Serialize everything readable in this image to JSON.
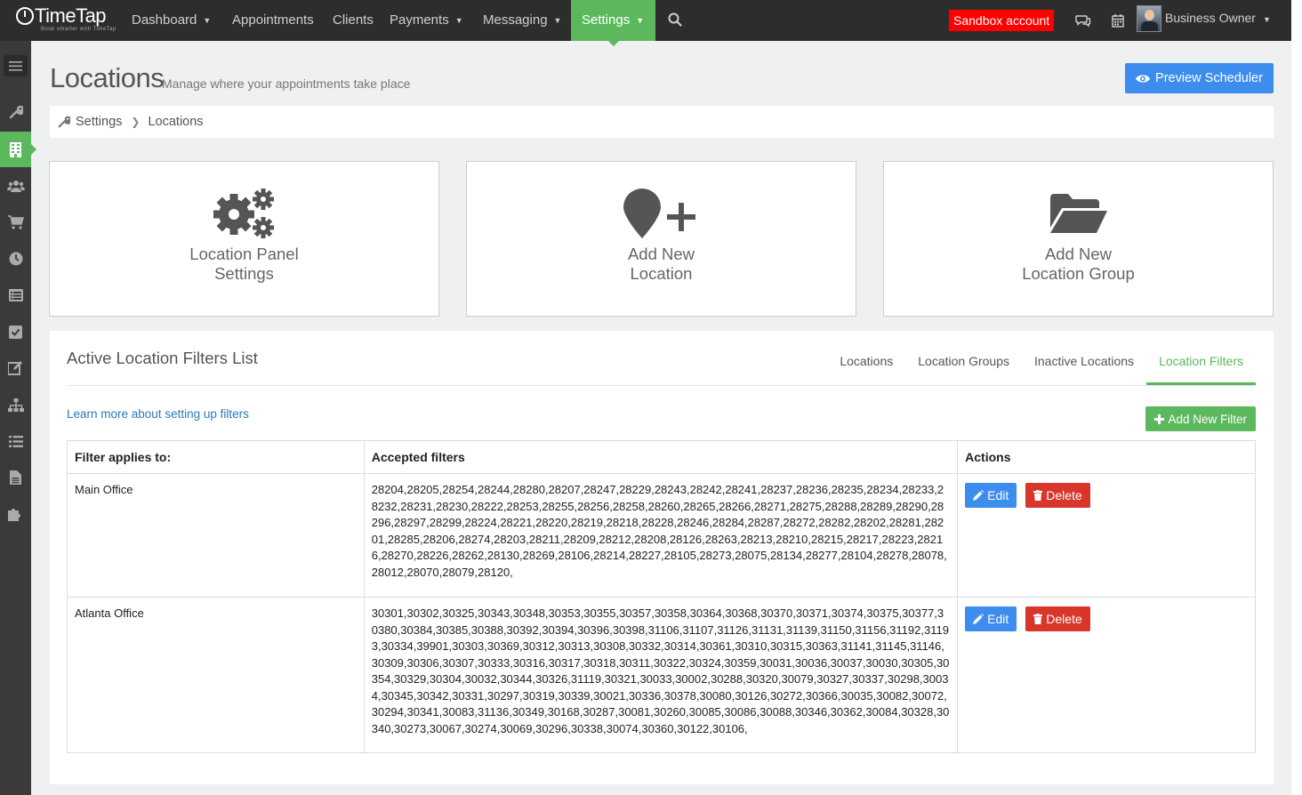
{
  "app": {
    "logo": "TimeTap",
    "tagline": "Book smarter with TimeTap"
  },
  "nav": {
    "items": [
      {
        "label": "Dashboard",
        "dropdown": true
      },
      {
        "label": "Appointments",
        "dropdown": false
      },
      {
        "label": "Clients",
        "dropdown": false
      },
      {
        "label": "Payments",
        "dropdown": true
      },
      {
        "label": "Messaging",
        "dropdown": true
      },
      {
        "label": "Settings",
        "dropdown": true,
        "active": true
      }
    ],
    "sandbox_label": "Sandbox account",
    "user_name": "Business Owner",
    "accent_color": "#5cb85c"
  },
  "sidebar": {
    "icons": [
      "menu-icon",
      "wrench-icon",
      "building-icon",
      "users-icon",
      "cart-icon",
      "clock-icon",
      "list-alt-icon",
      "check-square-icon",
      "edit-icon",
      "sitemap-icon",
      "list-icon",
      "file-icon",
      "puzzle-icon"
    ],
    "active": "building-icon"
  },
  "header": {
    "title": "Locations",
    "subtitle": "Manage where your appointments take place",
    "preview_button": "Preview Scheduler"
  },
  "breadcrumb": {
    "items": [
      "Settings",
      "Locations"
    ]
  },
  "cards": [
    {
      "icon": "cogs-icon",
      "line1": "Location Panel",
      "line2": "Settings"
    },
    {
      "icon": "map-marker-plus-icon",
      "line1": "Add New",
      "line2": "Location"
    },
    {
      "icon": "folder-open-icon",
      "line1": "Add New",
      "line2": "Location Group"
    }
  ],
  "panel": {
    "title": "Active Location Filters List",
    "tabs": [
      "Locations",
      "Location Groups",
      "Inactive Locations",
      "Location Filters"
    ],
    "active_tab": "Location Filters",
    "learn_link": "Learn more about setting up filters",
    "add_button": "Add New Filter",
    "table": {
      "headers": [
        "Filter applies to:",
        "Accepted filters",
        "Actions"
      ],
      "rows": [
        {
          "name": "Main Office",
          "filters": "28204,28205,28254,28244,28280,28207,28247,28229,28243,28242,28241,28237,28236,28235,28234,28233,28232,28231,28230,28222,28253,28255,28256,28258,28260,28265,28266,28271,28275,28288,28289,28290,28296,28297,28299,28224,28221,28220,28219,28218,28228,28246,28284,28287,28272,28282,28202,28281,28201,28285,28206,28274,28203,28211,28209,28212,28208,28126,28263,28213,28210,28215,28217,28223,28216,28270,28226,28262,28130,28269,28106,28214,28227,28105,28273,28075,28134,28277,28104,28278,28078,28012,28070,28079,28120,",
          "edit": "Edit",
          "delete": "Delete"
        },
        {
          "name": "Atlanta Office",
          "filters": "30301,30302,30325,30343,30348,30353,30355,30357,30358,30364,30368,30370,30371,30374,30375,30377,30380,30384,30385,30388,30392,30394,30396,30398,31106,31107,31126,31131,31139,31150,31156,31192,31193,30334,39901,30303,30369,30312,30313,30308,30332,30314,30361,30310,30315,30363,31141,31145,31146,30309,30306,30307,30333,30316,30317,30318,30311,30322,30324,30359,30031,30036,30037,30030,30305,30354,30329,30304,30032,30344,30326,31119,30321,30033,30002,30288,30320,30079,30327,30337,30298,30034,30345,30342,30331,30297,30319,30339,30021,30336,30378,30080,30126,30272,30366,30035,30082,30072,30294,30341,30083,31136,30349,30168,30287,30081,30260,30085,30086,30088,30346,30362,30084,30328,30340,30273,30067,30274,30069,30296,30338,30074,30360,30122,30106,",
          "edit": "Edit",
          "delete": "Delete"
        }
      ]
    }
  }
}
